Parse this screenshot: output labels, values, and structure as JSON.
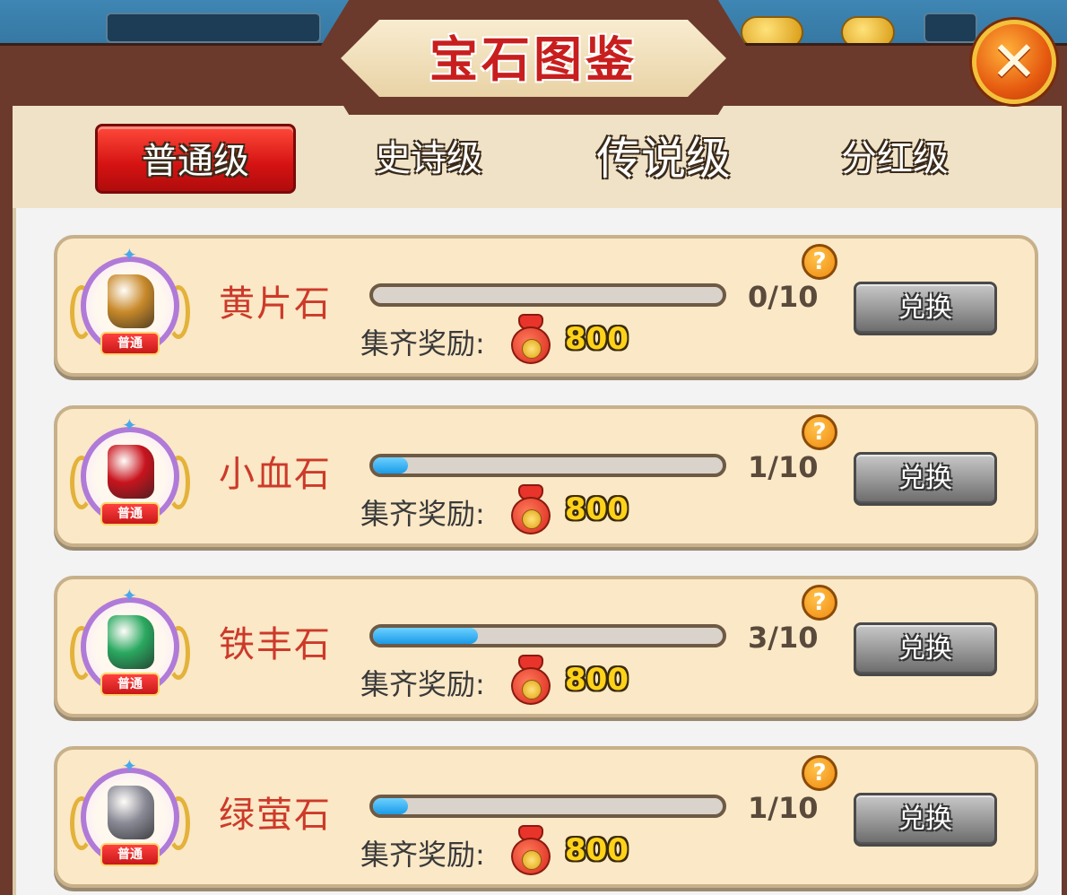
{
  "window": {
    "title": "宝石图鉴"
  },
  "tabs": [
    {
      "label": "普通级",
      "active": true
    },
    {
      "label": "史诗级",
      "active": false
    },
    {
      "label": "传说级",
      "active": false
    },
    {
      "label": "分红级",
      "active": false
    }
  ],
  "badge_label": "普通",
  "reward_label": "集齐奖励:",
  "exchange_label": "兑换",
  "help_label": "?",
  "close_label": "✕",
  "gems": [
    {
      "name": "黄片石",
      "count": "0/10",
      "progress": 0.0,
      "reward": "800",
      "gem_color": "#c8892a"
    },
    {
      "name": "小血石",
      "count": "1/10",
      "progress": 0.1,
      "reward": "800",
      "gem_color": "#c8141e"
    },
    {
      "name": "铁丰石",
      "count": "3/10",
      "progress": 0.3,
      "reward": "800",
      "gem_color": "#2aa860"
    },
    {
      "name": "绿萤石",
      "count": "1/10",
      "progress": 0.1,
      "reward": "800",
      "gem_color": "#8a8a96"
    }
  ],
  "colors": {
    "accent_red": "#d41212",
    "gem_name": "#cc3a2a",
    "progress_fill": "#1a9ae8",
    "reward_gold": "#ffd21a"
  }
}
